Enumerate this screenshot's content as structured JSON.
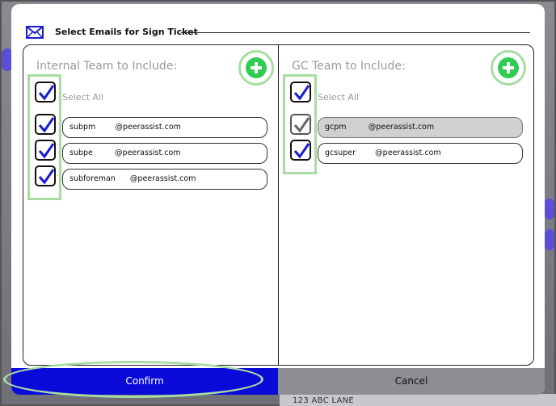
{
  "background": {
    "address": "123 ABC LANE"
  },
  "modal": {
    "title": "Select Emails for Sign Ticket",
    "icon": "mail-icon",
    "accent_color": "#0b0bd9",
    "add_color": "#2fcc54",
    "highlight_color": "#a8dca2"
  },
  "internal": {
    "title": "Internal Team to Include:",
    "select_all_label": "Select All",
    "select_all_checked": true,
    "emails": [
      {
        "value": "subpm        @peerassist.com",
        "checked": true,
        "disabled": false
      },
      {
        "value": "subpe         @peerassist.com",
        "checked": true,
        "disabled": false
      },
      {
        "value": "subforeman      @peerassist.com",
        "checked": true,
        "disabled": false
      }
    ]
  },
  "gc": {
    "title": "GC Team to Include:",
    "select_all_label": "Select All",
    "select_all_checked": true,
    "emails": [
      {
        "value": "gcpm         @peerassist.com",
        "checked": true,
        "disabled": true
      },
      {
        "value": "gcsuper        @peerassist.com",
        "checked": true,
        "disabled": false
      }
    ]
  },
  "footer": {
    "confirm_label": "Confirm",
    "cancel_label": "Cancel"
  }
}
